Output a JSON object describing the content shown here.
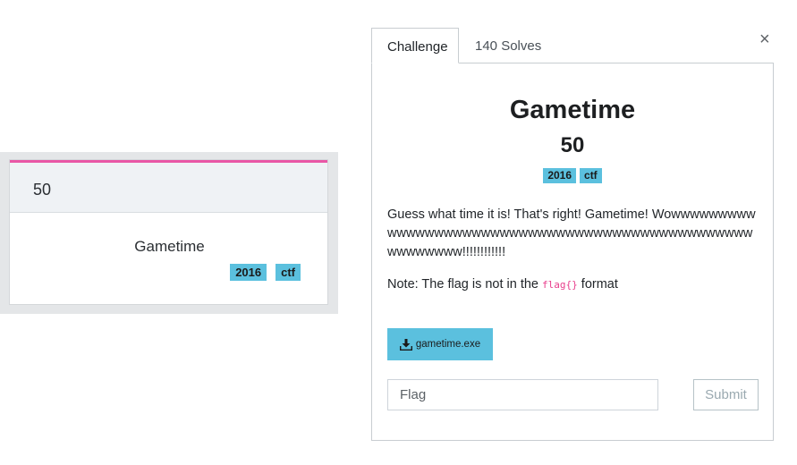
{
  "card": {
    "value": "50",
    "name": "Gametime",
    "tags": [
      "2016",
      "ctf"
    ],
    "accent_color": "#e957a6"
  },
  "modal": {
    "tabs": [
      "Challenge",
      "140 Solves"
    ],
    "close_icon": "×",
    "title": "Gametime",
    "value": "50",
    "tags": [
      "2016",
      "ctf"
    ],
    "description": "Guess what time it is! That's right! Gametime! Wowwwwwwwwwwwwwwwwwwwwwwwwwwwwwwwwwwwwwwwwwwwwwwwwwwwwwwww!!!!!!!!!!!!",
    "note_prefix": "Note: The flag is not in the ",
    "note_code": "flag{}",
    "note_suffix": " format",
    "file_button": "gametime.exe",
    "flag_placeholder": "Flag",
    "submit_label": "Submit",
    "tag_color": "#5bc0de"
  }
}
